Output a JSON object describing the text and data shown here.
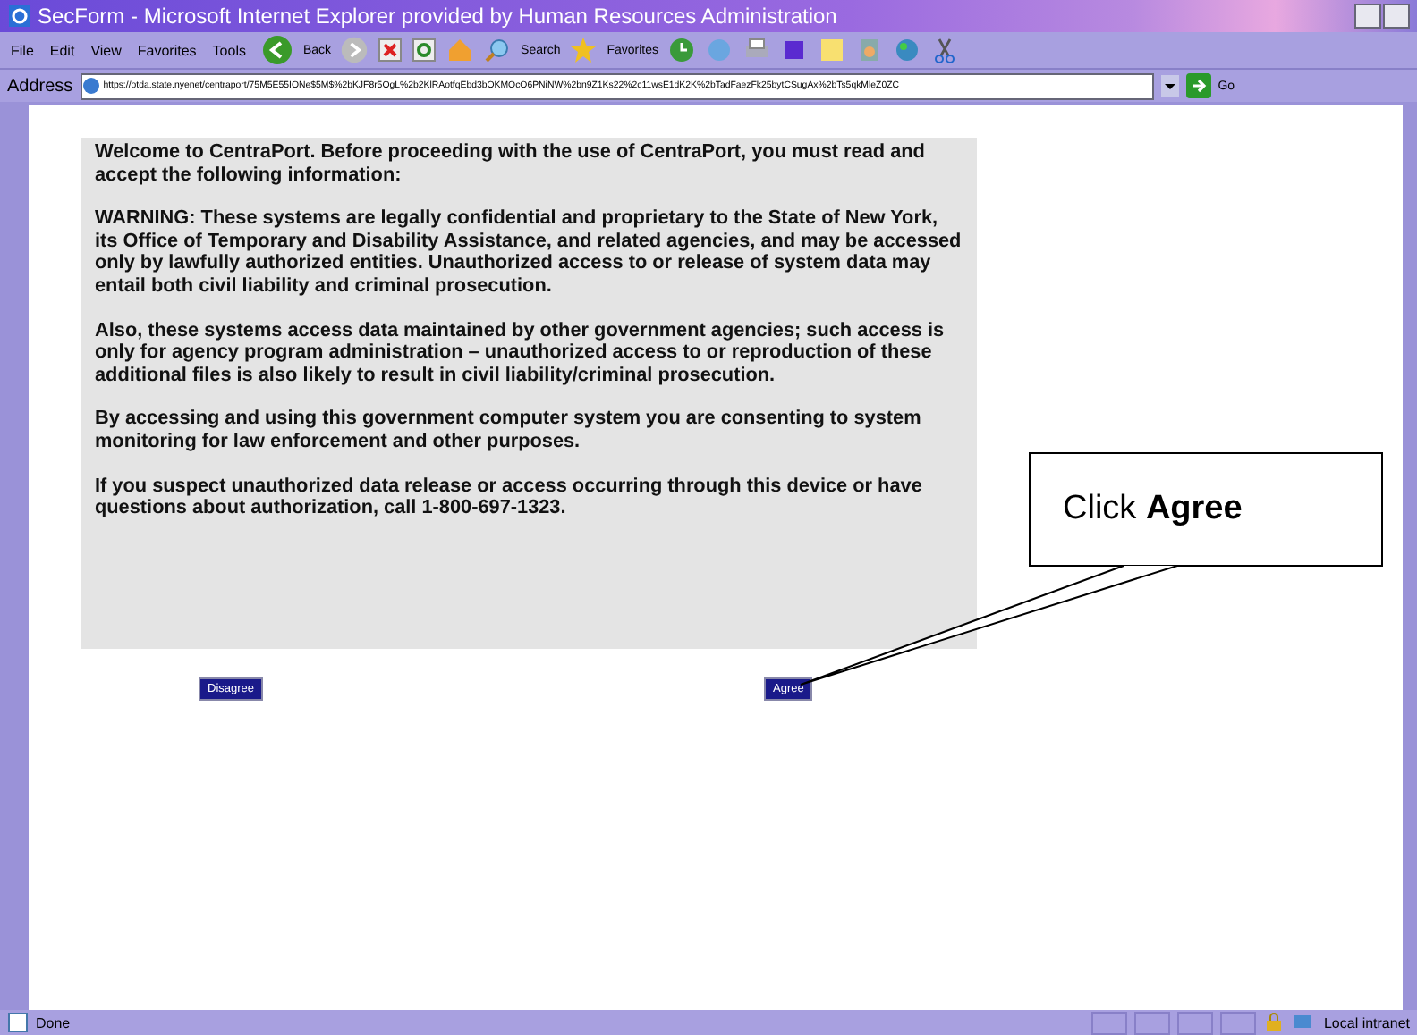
{
  "window": {
    "title": "SecForm - Microsoft Internet Explorer provided by Human Resources Administration"
  },
  "menu": [
    "File",
    "Edit",
    "View",
    "Favorites",
    "Tools"
  ],
  "toolbar": {
    "back": "Back",
    "search": "Search",
    "favorites": "Favorites"
  },
  "address": {
    "label": "Address",
    "value": "https://otda.state.nyenet/centraport/75M5E55IONe$5M$%2bKJF8r5OgL%2b2KlRAotfqEbd3bOKMOcO6PNiNW%2bn9Z1Ks22%2c11wsE1dK2K%2bTadFaezFk25bytCSugAx%2bTs5qkMleZ0ZC",
    "go": "Go"
  },
  "notice": [
    "Welcome to CentraPort. Before proceeding with the use of CentraPort, you must read and accept the following information:",
    "WARNING: These systems are legally confidential and proprietary to the State of New York, its Office of Temporary and Disability Assistance, and related agencies, and may be accessed only by lawfully authorized entities. Unauthorized access to or release of system data may entail both civil liability and criminal prosecution.",
    "Also, these systems access data maintained by other government agencies; such access is only for agency program administration – unauthorized access to or reproduction of these additional files is also likely to result in civil liability/criminal prosecution.",
    "By accessing and using this government computer system you are consenting to system monitoring for law enforcement and other purposes.",
    "If you suspect unauthorized data release or access occurring through this device or have questions about authorization, call 1-800-697-1323."
  ],
  "buttons": [
    "Disagree",
    "Agree"
  ],
  "callout": "Click **Agree**",
  "status_bar": {
    "text": "Done",
    "zone": "Local intranet"
  }
}
